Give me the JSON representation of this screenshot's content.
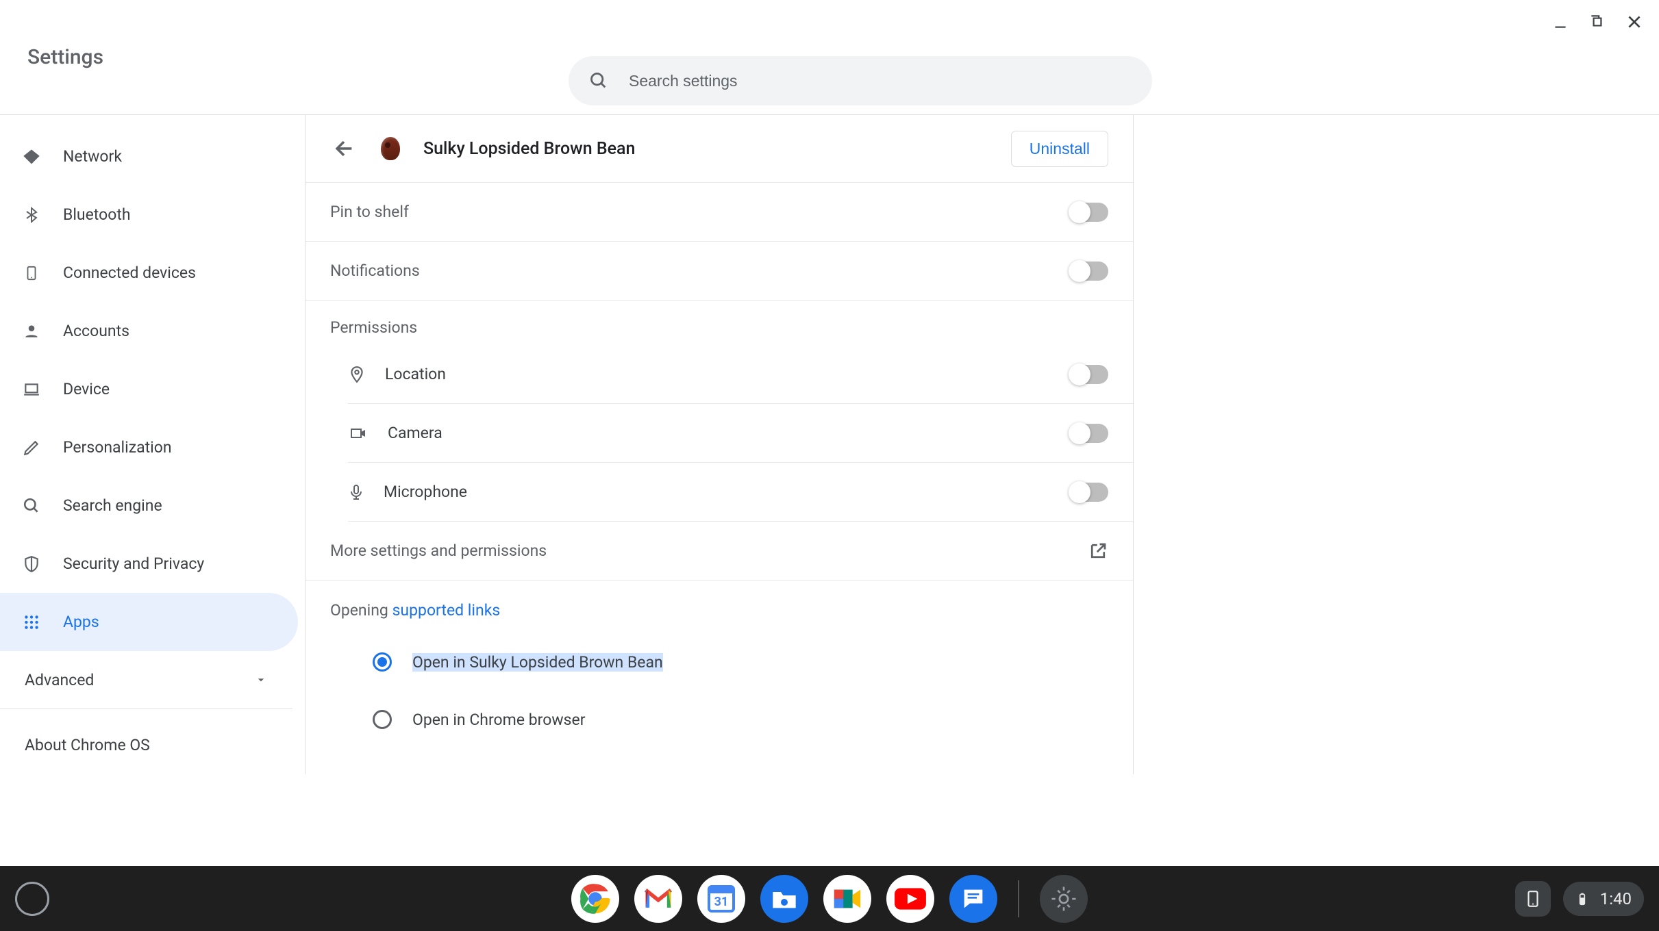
{
  "windowControls": {
    "minimize": "minimize",
    "maximize": "maximize",
    "close": "close"
  },
  "header": {
    "title": "Settings"
  },
  "search": {
    "placeholder": "Search settings"
  },
  "sidebar": {
    "items": [
      {
        "id": "network",
        "label": "Network"
      },
      {
        "id": "bluetooth",
        "label": "Bluetooth"
      },
      {
        "id": "connected-devices",
        "label": "Connected devices"
      },
      {
        "id": "accounts",
        "label": "Accounts"
      },
      {
        "id": "device",
        "label": "Device"
      },
      {
        "id": "personalization",
        "label": "Personalization"
      },
      {
        "id": "search-engine",
        "label": "Search engine"
      },
      {
        "id": "security-privacy",
        "label": "Security and Privacy"
      },
      {
        "id": "apps",
        "label": "Apps"
      }
    ],
    "advanced": "Advanced",
    "about": "About Chrome OS",
    "activeIndex": 8
  },
  "detail": {
    "appName": "Sulky Lopsided Brown Bean",
    "uninstall": "Uninstall",
    "pinToShelf": "Pin to shelf",
    "notifications": "Notifications",
    "permissionsHeading": "Permissions",
    "permissions": [
      {
        "id": "location",
        "label": "Location"
      },
      {
        "id": "camera",
        "label": "Camera"
      },
      {
        "id": "microphone",
        "label": "Microphone"
      }
    ],
    "moreSettings": "More settings and permissions",
    "openingPrefix": "Opening ",
    "supportedLinks": "supported links",
    "radios": [
      {
        "id": "open-in-app",
        "label": "Open in Sulky Lopsided Brown Bean",
        "selected": true,
        "highlighted": true
      },
      {
        "id": "open-in-chrome",
        "label": "Open in Chrome browser",
        "selected": false,
        "highlighted": false
      }
    ],
    "toggles": {
      "pinToShelf": false,
      "notifications": false,
      "location": false,
      "camera": false,
      "microphone": false
    }
  },
  "shelf": {
    "apps": [
      {
        "id": "chrome",
        "name": "Chrome"
      },
      {
        "id": "gmail",
        "name": "Gmail"
      },
      {
        "id": "calendar",
        "name": "Calendar",
        "badge": "31"
      },
      {
        "id": "files",
        "name": "Files"
      },
      {
        "id": "meet",
        "name": "Meet"
      },
      {
        "id": "youtube",
        "name": "YouTube"
      },
      {
        "id": "messages",
        "name": "Messages"
      },
      {
        "id": "settings",
        "name": "Settings"
      }
    ],
    "time": "1:40"
  }
}
